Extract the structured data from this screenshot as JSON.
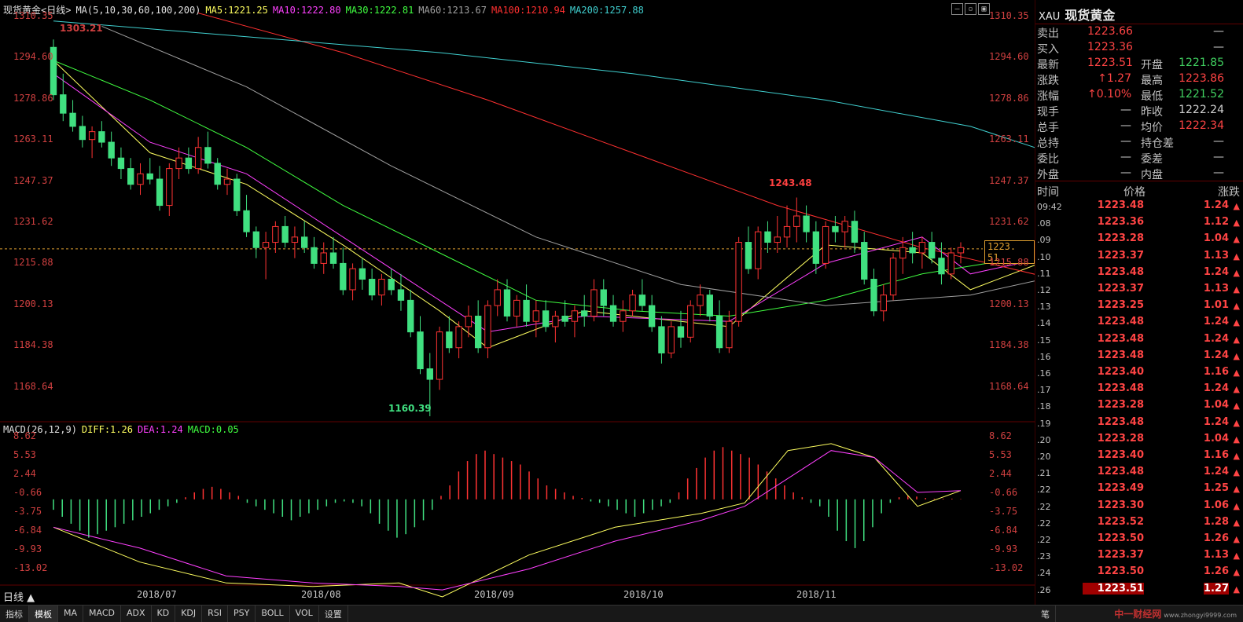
{
  "header": {
    "title": "现货黄金<日线>",
    "ma_label": "MA(5,10,30,60,100,200)",
    "ma5": "MA5:1221.25",
    "ma10": "MA10:1222.80",
    "ma30": "MA30:1222.81",
    "ma60": "MA60:1213.67",
    "ma100": "MA100:1210.94",
    "ma200": "MA200:1257.88"
  },
  "macd_header": {
    "label": "MACD(26,12,9)",
    "diff": "DIFF:1.26",
    "dea": "DEA:1.24",
    "macd": "MACD:0.05"
  },
  "price_axis": [
    "1310.35",
    "1294.60",
    "1278.86",
    "1263.11",
    "1247.37",
    "1231.62",
    "1215.88",
    "1200.13",
    "1184.38",
    "1168.64"
  ],
  "macd_axis": [
    "8.62",
    "5.53",
    "2.44",
    "-0.66",
    "-3.75",
    "-6.84",
    "-9.93",
    "-13.02"
  ],
  "x_axis": [
    "2018/07",
    "2018/08",
    "2018/09",
    "2018/10",
    "2018/11"
  ],
  "annotations": {
    "high_start": "1303.21",
    "low": "1160.39",
    "high": "1243.48"
  },
  "current_price_tag": "1223. 51",
  "period_label": "日线",
  "colors": {
    "up": "#ff3333",
    "down": "#40e080",
    "ma5": "#ffff60",
    "ma10": "#ff40ff",
    "ma30": "#40ff40",
    "ma60": "#a0a0a0",
    "ma100": "#ff3030",
    "ma200": "#40d0d0"
  },
  "quote": {
    "symbol": "XAU",
    "name": "现货黄金",
    "rows": [
      {
        "l1": "卖出",
        "v1": "1223.66",
        "l2": "",
        "v2": "—"
      },
      {
        "l1": "买入",
        "v1": "1223.36",
        "l2": "",
        "v2": "—"
      },
      {
        "l1": "最新",
        "v1": "1223.51",
        "l2": "开盘",
        "v2": "1221.85"
      },
      {
        "l1": "涨跌",
        "v1": "↑1.27",
        "l2": "最高",
        "v2": "1223.86"
      },
      {
        "l1": "涨幅",
        "v1": "↑0.10%",
        "l2": "最低",
        "v2": "1221.52"
      },
      {
        "l1": "现手",
        "v1": "—",
        "l2": "昨收",
        "v2": "1222.24"
      },
      {
        "l1": "总手",
        "v1": "—",
        "l2": "均价",
        "v2": "1222.34"
      },
      {
        "l1": "总持",
        "v1": "—",
        "l2": "持仓差",
        "v2": "—"
      },
      {
        "l1": "委比",
        "v1": "—",
        "l2": "委差",
        "v2": "—"
      },
      {
        "l1": "外盘",
        "v1": "—",
        "l2": "内盘",
        "v2": "—"
      }
    ],
    "ticks_header": {
      "time": "时间",
      "price": "价格",
      "change": "涨跌"
    },
    "ticks": [
      {
        "t": "09:42",
        "p": "1223.48",
        "c": "1.24"
      },
      {
        "t": ".08",
        "p": "1223.36",
        "c": "1.12"
      },
      {
        "t": ".09",
        "p": "1223.28",
        "c": "1.04"
      },
      {
        "t": ".10",
        "p": "1223.37",
        "c": "1.13"
      },
      {
        "t": ".11",
        "p": "1223.48",
        "c": "1.24"
      },
      {
        "t": ".12",
        "p": "1223.37",
        "c": "1.13"
      },
      {
        "t": ".13",
        "p": "1223.25",
        "c": "1.01"
      },
      {
        "t": ".14",
        "p": "1223.48",
        "c": "1.24"
      },
      {
        "t": ".15",
        "p": "1223.48",
        "c": "1.24"
      },
      {
        "t": ".16",
        "p": "1223.48",
        "c": "1.24"
      },
      {
        "t": ".16",
        "p": "1223.40",
        "c": "1.16"
      },
      {
        "t": ".17",
        "p": "1223.48",
        "c": "1.24"
      },
      {
        "t": ".18",
        "p": "1223.28",
        "c": "1.04"
      },
      {
        "t": ".19",
        "p": "1223.48",
        "c": "1.24"
      },
      {
        "t": ".20",
        "p": "1223.28",
        "c": "1.04"
      },
      {
        "t": ".20",
        "p": "1223.40",
        "c": "1.16"
      },
      {
        "t": ".21",
        "p": "1223.48",
        "c": "1.24"
      },
      {
        "t": ".22",
        "p": "1223.49",
        "c": "1.25"
      },
      {
        "t": ".22",
        "p": "1223.30",
        "c": "1.06"
      },
      {
        "t": ".22",
        "p": "1223.52",
        "c": "1.28"
      },
      {
        "t": ".22",
        "p": "1223.50",
        "c": "1.26"
      },
      {
        "t": ".23",
        "p": "1223.37",
        "c": "1.13"
      },
      {
        "t": ".24",
        "p": "1223.50",
        "c": "1.26"
      },
      {
        "t": ".26",
        "p": "1223.51",
        "c": "1.27"
      }
    ]
  },
  "bottom_tabs": [
    "指标",
    "模板",
    "MA",
    "MACD",
    "ADX",
    "KD",
    "KDJ",
    "RSI",
    "PSY",
    "BOLL",
    "VOL",
    "设置"
  ],
  "bottom_right_tab": "笔",
  "brand": "中一财经网",
  "brand_url": "www.zhongyi9999.com",
  "chart_data": [
    {
      "type": "candlestick",
      "title": "现货黄金<日线>",
      "ylim": [
        1160,
        1312
      ],
      "candles": [
        [
          1300,
          1303,
          1280,
          1282
        ],
        [
          1282,
          1290,
          1272,
          1275
        ],
        [
          1275,
          1280,
          1268,
          1270
        ],
        [
          1270,
          1274,
          1262,
          1265
        ],
        [
          1265,
          1270,
          1258,
          1268
        ],
        [
          1268,
          1272,
          1262,
          1264
        ],
        [
          1264,
          1268,
          1255,
          1258
        ],
        [
          1258,
          1262,
          1250,
          1254
        ],
        [
          1254,
          1258,
          1246,
          1248
        ],
        [
          1248,
          1256,
          1244,
          1252
        ],
        [
          1252,
          1258,
          1248,
          1250
        ],
        [
          1250,
          1255,
          1238,
          1240
        ],
        [
          1240,
          1256,
          1236,
          1254
        ],
        [
          1254,
          1262,
          1250,
          1258
        ],
        [
          1258,
          1262,
          1252,
          1254
        ],
        [
          1254,
          1266,
          1252,
          1262
        ],
        [
          1262,
          1268,
          1254,
          1256
        ],
        [
          1256,
          1258,
          1246,
          1248
        ],
        [
          1248,
          1254,
          1244,
          1250
        ],
        [
          1250,
          1252,
          1236,
          1238
        ],
        [
          1238,
          1244,
          1228,
          1230
        ],
        [
          1230,
          1232,
          1220,
          1224
        ],
        [
          1224,
          1230,
          1212,
          1226
        ],
        [
          1226,
          1234,
          1222,
          1232
        ],
        [
          1232,
          1236,
          1224,
          1226
        ],
        [
          1226,
          1232,
          1220,
          1228
        ],
        [
          1228,
          1234,
          1222,
          1224
        ],
        [
          1224,
          1228,
          1216,
          1218
        ],
        [
          1218,
          1226,
          1214,
          1222
        ],
        [
          1222,
          1228,
          1216,
          1218
        ],
        [
          1218,
          1224,
          1206,
          1208
        ],
        [
          1208,
          1218,
          1204,
          1216
        ],
        [
          1216,
          1220,
          1208,
          1212
        ],
        [
          1212,
          1216,
          1204,
          1206
        ],
        [
          1206,
          1214,
          1202,
          1212
        ],
        [
          1212,
          1216,
          1206,
          1208
        ],
        [
          1208,
          1214,
          1200,
          1204
        ],
        [
          1204,
          1208,
          1190,
          1192
        ],
        [
          1192,
          1198,
          1176,
          1178
        ],
        [
          1178,
          1184,
          1160,
          1174
        ],
        [
          1174,
          1194,
          1170,
          1192
        ],
        [
          1192,
          1198,
          1184,
          1186
        ],
        [
          1186,
          1196,
          1182,
          1194
        ],
        [
          1194,
          1202,
          1190,
          1198
        ],
        [
          1198,
          1204,
          1184,
          1186
        ],
        [
          1186,
          1204,
          1182,
          1202
        ],
        [
          1202,
          1212,
          1198,
          1208
        ],
        [
          1208,
          1212,
          1196,
          1198
        ],
        [
          1198,
          1206,
          1194,
          1204
        ],
        [
          1204,
          1210,
          1194,
          1196
        ],
        [
          1196,
          1204,
          1190,
          1200
        ],
        [
          1200,
          1204,
          1192,
          1194
        ],
        [
          1194,
          1200,
          1188,
          1198
        ],
        [
          1198,
          1204,
          1194,
          1196
        ],
        [
          1196,
          1202,
          1190,
          1200
        ],
        [
          1200,
          1206,
          1194,
          1198
        ],
        [
          1198,
          1212,
          1196,
          1208
        ],
        [
          1208,
          1212,
          1198,
          1202
        ],
        [
          1202,
          1206,
          1194,
          1196
        ],
        [
          1196,
          1204,
          1192,
          1200
        ],
        [
          1200,
          1208,
          1198,
          1206
        ],
        [
          1206,
          1212,
          1200,
          1202
        ],
        [
          1202,
          1206,
          1192,
          1194
        ],
        [
          1194,
          1198,
          1180,
          1184
        ],
        [
          1184,
          1196,
          1182,
          1194
        ],
        [
          1194,
          1200,
          1186,
          1190
        ],
        [
          1190,
          1204,
          1188,
          1202
        ],
        [
          1202,
          1210,
          1198,
          1206
        ],
        [
          1206,
          1208,
          1196,
          1198
        ],
        [
          1198,
          1204,
          1184,
          1186
        ],
        [
          1186,
          1200,
          1184,
          1196
        ],
        [
          1196,
          1228,
          1194,
          1226
        ],
        [
          1226,
          1232,
          1214,
          1216
        ],
        [
          1216,
          1232,
          1212,
          1230
        ],
        [
          1230,
          1234,
          1222,
          1226
        ],
        [
          1226,
          1236,
          1222,
          1228
        ],
        [
          1228,
          1240,
          1224,
          1232
        ],
        [
          1232,
          1243,
          1226,
          1236
        ],
        [
          1236,
          1240,
          1226,
          1230
        ],
        [
          1230,
          1234,
          1214,
          1218
        ],
        [
          1218,
          1234,
          1216,
          1232
        ],
        [
          1232,
          1236,
          1226,
          1230
        ],
        [
          1230,
          1236,
          1224,
          1234
        ],
        [
          1234,
          1238,
          1222,
          1226
        ],
        [
          1226,
          1230,
          1210,
          1212
        ],
        [
          1212,
          1216,
          1198,
          1200
        ],
        [
          1200,
          1210,
          1196,
          1206
        ],
        [
          1206,
          1222,
          1204,
          1220
        ],
        [
          1220,
          1228,
          1214,
          1224
        ],
        [
          1224,
          1230,
          1218,
          1222
        ],
        [
          1222,
          1228,
          1216,
          1226
        ],
        [
          1226,
          1230,
          1218,
          1220
        ],
        [
          1220,
          1226,
          1210,
          1214
        ],
        [
          1214,
          1224,
          1212,
          1222
        ],
        [
          1222,
          1226,
          1218,
          1224
        ]
      ],
      "ma": {
        "MA5": [
          [
            0,
            1295
          ],
          [
            10,
            1260
          ],
          [
            20,
            1248
          ],
          [
            30,
            1225
          ],
          [
            40,
            1200
          ],
          [
            45,
            1186
          ],
          [
            55,
            1200
          ],
          [
            70,
            1194
          ],
          [
            80,
            1225
          ],
          [
            90,
            1222
          ],
          [
            95,
            1208
          ],
          [
            105,
            1222
          ]
        ],
        "MA10": [
          [
            0,
            1290
          ],
          [
            10,
            1264
          ],
          [
            20,
            1252
          ],
          [
            30,
            1228
          ],
          [
            40,
            1204
          ],
          [
            45,
            1192
          ],
          [
            55,
            1198
          ],
          [
            70,
            1196
          ],
          [
            80,
            1218
          ],
          [
            90,
            1228
          ],
          [
            95,
            1214
          ],
          [
            105,
            1222
          ]
        ],
        "MA30": [
          [
            0,
            1295
          ],
          [
            10,
            1280
          ],
          [
            20,
            1262
          ],
          [
            30,
            1240
          ],
          [
            40,
            1222
          ],
          [
            50,
            1204
          ],
          [
            60,
            1200
          ],
          [
            70,
            1198
          ],
          [
            80,
            1204
          ],
          [
            90,
            1214
          ],
          [
            100,
            1220
          ],
          [
            105,
            1222
          ]
        ],
        "MA60": [
          [
            5,
            1308
          ],
          [
            20,
            1285
          ],
          [
            35,
            1255
          ],
          [
            50,
            1228
          ],
          [
            65,
            1210
          ],
          [
            80,
            1202
          ],
          [
            95,
            1206
          ],
          [
            105,
            1214
          ]
        ],
        "MA100": [
          [
            15,
            1313
          ],
          [
            30,
            1298
          ],
          [
            45,
            1280
          ],
          [
            60,
            1260
          ],
          [
            75,
            1240
          ],
          [
            90,
            1224
          ],
          [
            105,
            1211
          ]
        ],
        "MA200": [
          [
            0,
            1310
          ],
          [
            20,
            1304
          ],
          [
            40,
            1298
          ],
          [
            60,
            1290
          ],
          [
            80,
            1280
          ],
          [
            95,
            1270
          ],
          [
            105,
            1258
          ]
        ]
      }
    },
    {
      "type": "bar",
      "title": "MACD(26,12,9)",
      "ylim": [
        -14,
        9
      ],
      "histogram": [
        -1.5,
        -2.5,
        -3.5,
        -4.5,
        -5.5,
        -5,
        -4.5,
        -4,
        -3.5,
        -3,
        -2.5,
        -2,
        -1.5,
        -1,
        -0.5,
        0.3,
        1,
        1.5,
        1.8,
        1.5,
        1,
        0.5,
        -0.5,
        -1,
        -1.5,
        -2,
        -2.5,
        -3,
        -2.5,
        -2,
        -1.5,
        -1,
        -0.5,
        -0.3,
        -0.5,
        -1,
        -2,
        -3.5,
        -4.5,
        -5.5,
        -5,
        -4,
        -3,
        -1.5,
        0.5,
        2,
        4,
        5.5,
        6.5,
        7,
        6.5,
        6,
        5.5,
        5,
        4,
        3,
        2,
        1.5,
        1,
        0.5,
        0.2,
        -0.3,
        -0.5,
        -1,
        -1.5,
        -2,
        -2.5,
        -2,
        -1.5,
        -1,
        -0.5,
        1,
        3,
        4.5,
        6,
        7,
        7.5,
        7,
        6.5,
        6,
        5,
        4,
        3,
        2,
        1,
        0.3,
        -0.5,
        -1,
        -2.5,
        -4.5,
        -6,
        -7,
        -6,
        -4,
        -2,
        -0.5,
        0.3,
        0.5,
        0.4,
        0.2,
        0.1,
        0.1,
        0.1,
        0.05
      ],
      "diff": [
        [
          0,
          -4
        ],
        [
          10,
          -9
        ],
        [
          20,
          -12
        ],
        [
          30,
          -12.5
        ],
        [
          40,
          -12
        ],
        [
          45,
          -14
        ],
        [
          55,
          -8
        ],
        [
          65,
          -4
        ],
        [
          75,
          -2
        ],
        [
          80,
          -0.5
        ],
        [
          85,
          7
        ],
        [
          90,
          8
        ],
        [
          95,
          6
        ],
        [
          100,
          -1
        ],
        [
          105,
          1.26
        ]
      ],
      "dea": [
        [
          0,
          -4
        ],
        [
          10,
          -7
        ],
        [
          20,
          -11
        ],
        [
          30,
          -12
        ],
        [
          40,
          -12.5
        ],
        [
          45,
          -13
        ],
        [
          55,
          -10
        ],
        [
          65,
          -6
        ],
        [
          75,
          -3
        ],
        [
          80,
          -1
        ],
        [
          85,
          3
        ],
        [
          90,
          7
        ],
        [
          95,
          6
        ],
        [
          100,
          1
        ],
        [
          105,
          1.24
        ]
      ]
    }
  ]
}
